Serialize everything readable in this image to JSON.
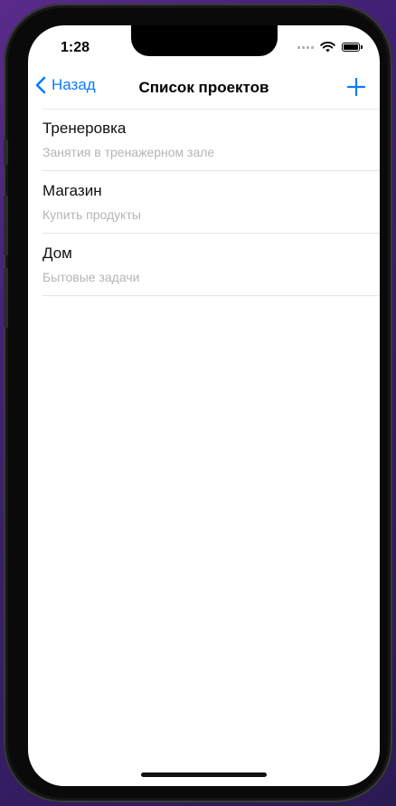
{
  "status_bar": {
    "time": "1:28"
  },
  "navbar": {
    "back_label": "Назад",
    "title": "Список проектов",
    "add_icon": "plus-icon"
  },
  "projects": [
    {
      "title": "Тренеровка",
      "subtitle": "Занятия в тренажерном зале"
    },
    {
      "title": "Магазин",
      "subtitle": "Купить продукты"
    },
    {
      "title": "Дом",
      "subtitle": "Бытовые задачи"
    }
  ],
  "colors": {
    "accent": "#0a7aff",
    "subtitle": "#b5b5ba",
    "separator": "#e4e4e6",
    "wallpaper": "#5a2a8a"
  }
}
